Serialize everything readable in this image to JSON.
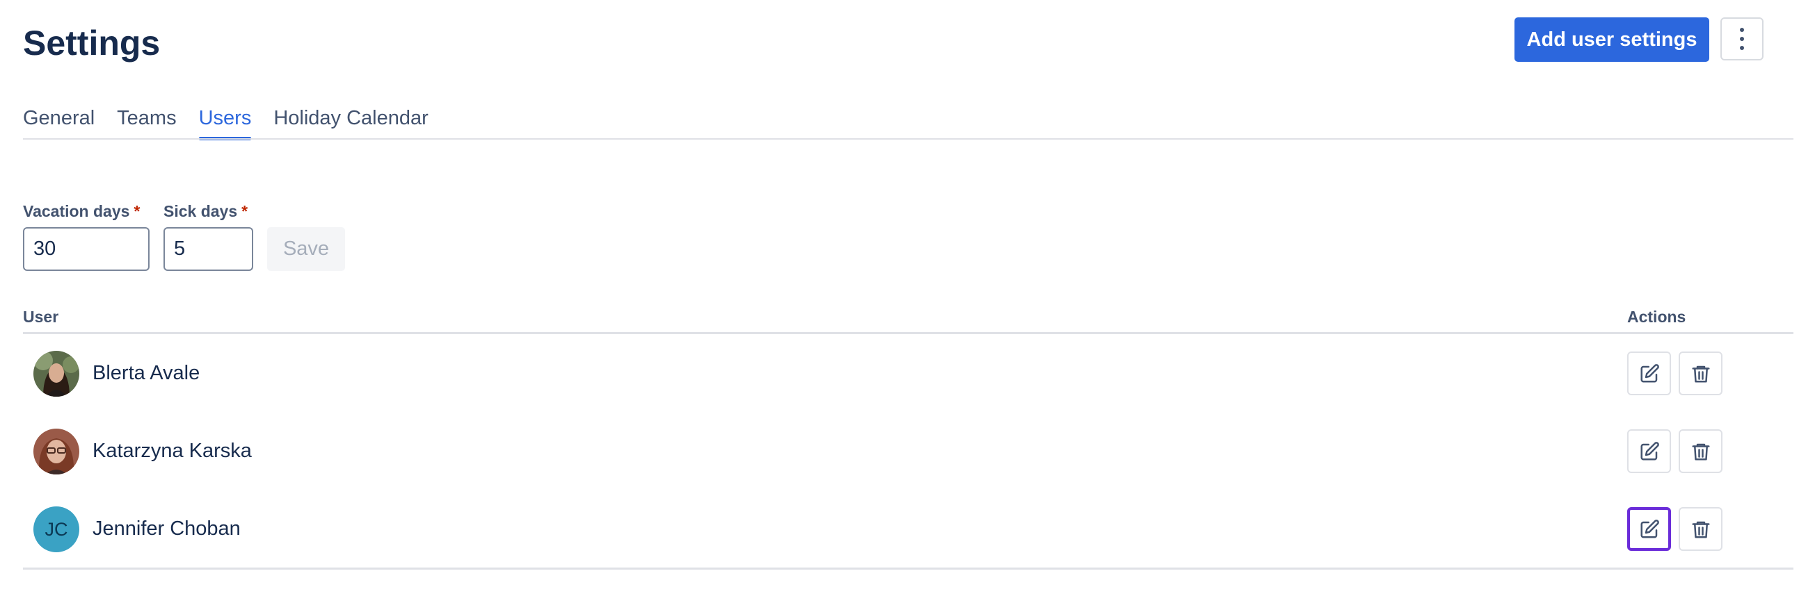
{
  "header": {
    "title": "Settings",
    "add_button_label": "Add user settings",
    "more_icon": "more-vertical-icon"
  },
  "tabs": [
    {
      "label": "General",
      "active": false
    },
    {
      "label": "Teams",
      "active": false
    },
    {
      "label": "Users",
      "active": true
    },
    {
      "label": "Holiday Calendar",
      "active": false
    }
  ],
  "form": {
    "vacation_label": "Vacation days",
    "vacation_value": "30",
    "sick_label": "Sick days",
    "sick_value": "5",
    "required_mark": "*",
    "save_label": "Save"
  },
  "table": {
    "col_user": "User",
    "col_actions": "Actions",
    "rows": [
      {
        "name": "Blerta Avale",
        "avatar": "photo",
        "edit_icon": "edit-icon",
        "delete_icon": "trash-icon"
      },
      {
        "name": "Katarzyna Karska",
        "avatar": "photo",
        "edit_icon": "edit-icon",
        "delete_icon": "trash-icon"
      },
      {
        "name": "Jennifer Choban",
        "avatar_initials": "JC",
        "edit_icon": "edit-icon",
        "delete_icon": "trash-icon"
      }
    ]
  },
  "colors": {
    "primary": "#2c67dd",
    "text": "#172b4d",
    "focus_ring": "#6a2cd9",
    "initials_avatar": "#3aa2c4"
  }
}
